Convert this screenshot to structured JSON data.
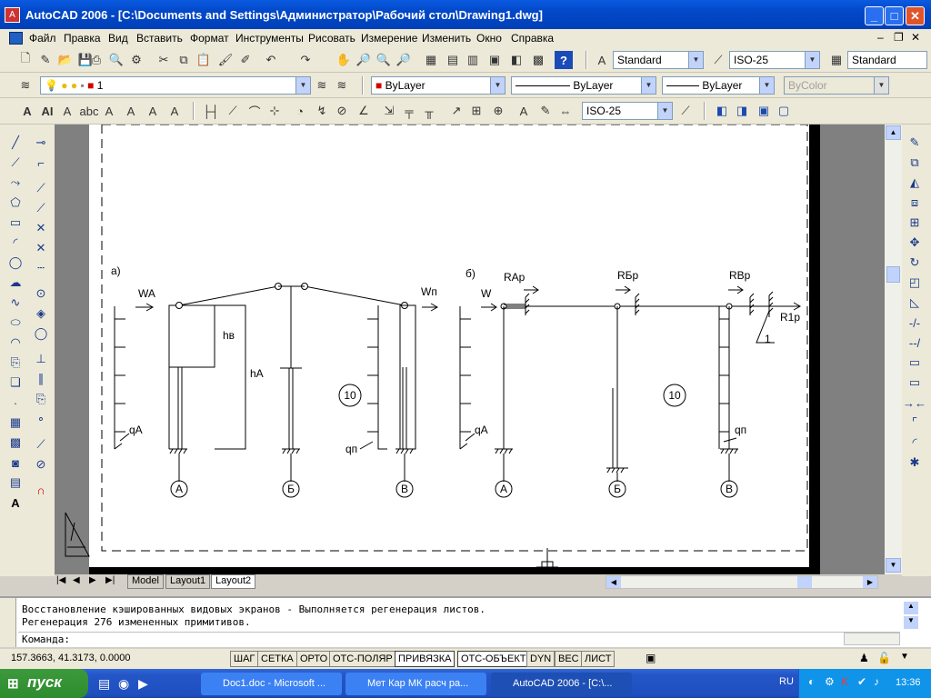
{
  "window": {
    "title": "AutoCAD 2006 - [C:\\Documents and Settings\\Администратор\\Рабочий стол\\Drawing1.dwg]"
  },
  "menu": [
    "Файл",
    "Правка",
    "Вид",
    "Вставить",
    "Формат",
    "Инструменты",
    "Рисовать",
    "Измерение",
    "Изменить",
    "Окно",
    "Справка"
  ],
  "toolbar1": {
    "text_style": "Standard",
    "dim_style": "ISO-25",
    "table_style": "Standard"
  },
  "toolbar2": {
    "layer": "1",
    "color": "ByLayer",
    "linetype": "ByLayer",
    "lineweight": "ByLayer",
    "plotstyle": "ByColor"
  },
  "toolbar3": {
    "dim_style": "ISO-25"
  },
  "drawing": {
    "label_a": "а)",
    "label_b": "б)",
    "wa": "WA",
    "wn": "Wп",
    "w": "W",
    "hb": "hв",
    "ha": "hA",
    "qa_left": "qA",
    "qn_left": "qп",
    "qa_right": "qA",
    "qn_right": "qп",
    "circle10_left": "10",
    "circle10_right": "10",
    "axis_left": [
      "A",
      "Б",
      "В"
    ],
    "axis_right": [
      "A",
      "Б",
      "В"
    ],
    "rap": "RAp",
    "rbp": "RБp",
    "rvp": "RBp",
    "r1p": "R1p",
    "mark1": "1"
  },
  "tabs": [
    "Model",
    "Layout1",
    "Layout2"
  ],
  "command": {
    "line1": "Восстановление кэшированных видовых экранов - Выполняется регенерация листов.",
    "line2": "Регенерация 276 измененных примитивов.",
    "prompt": "Команда:"
  },
  "status": {
    "coords": "157.3663, 41.3173, 0.0000",
    "buttons": [
      "ШАГ",
      "СЕТКА",
      "ОРТО",
      "ОТС-ПОЛЯР",
      "ПРИВЯЗКА",
      "ОТС-ОБЪЕКТ",
      "DYN",
      "ВЕС",
      "ЛИСТ"
    ]
  },
  "taskbar": {
    "start": "пуск",
    "tasks": [
      "Doc1.doc - Microsoft ...",
      "Мет Кар МК расч ра...",
      "AutoCAD 2006 - [C:\\..."
    ],
    "lang": "RU",
    "clock": "13:36"
  }
}
